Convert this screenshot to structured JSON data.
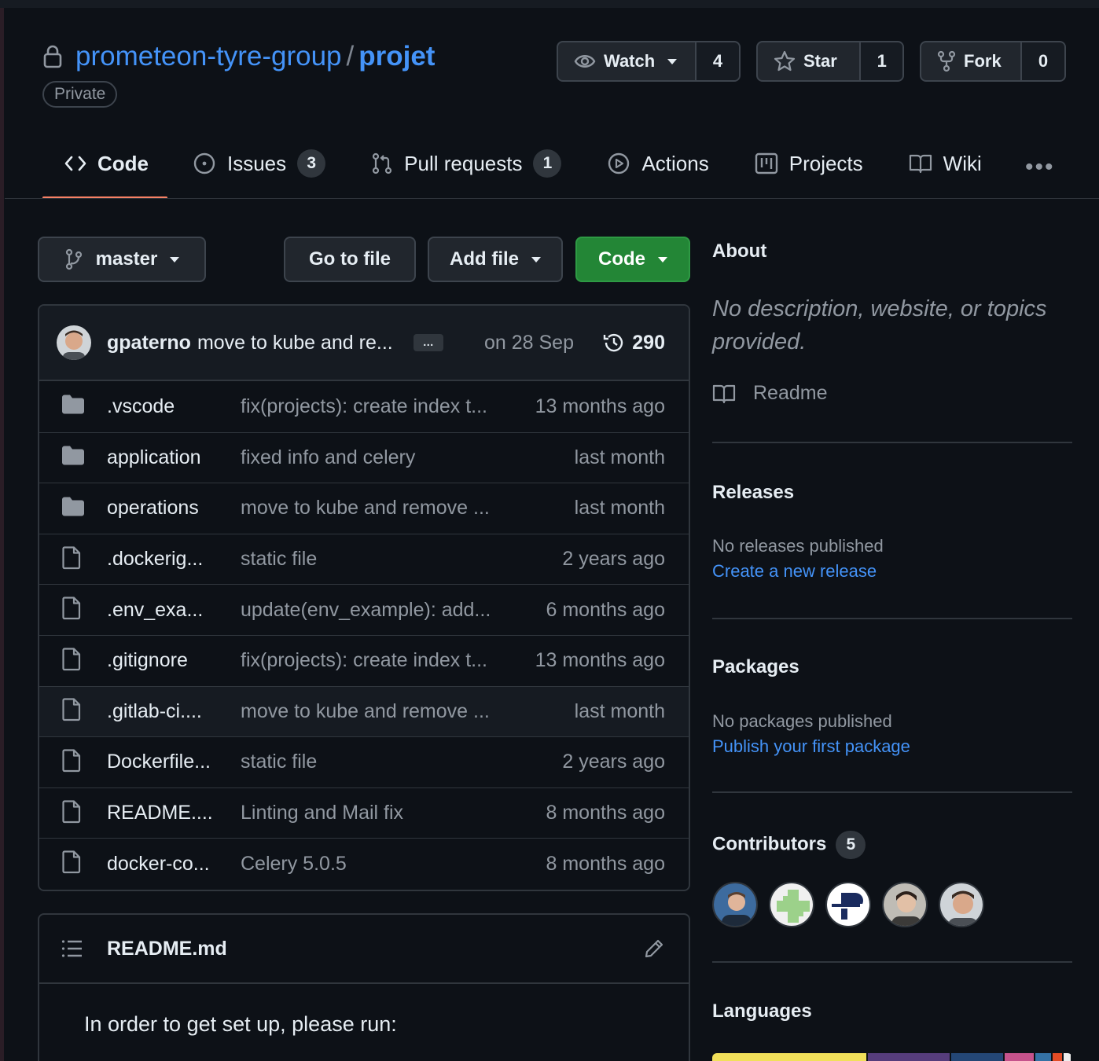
{
  "repo": {
    "owner": "prometeon-tyre-group",
    "separator": "/",
    "name": "projet",
    "visibility": "Private"
  },
  "header_buttons": {
    "watch": {
      "label": "Watch",
      "count": "4"
    },
    "star": {
      "label": "Star",
      "count": "1"
    },
    "fork": {
      "label": "Fork",
      "count": "0"
    }
  },
  "tabs": [
    {
      "label": "Code",
      "icon": "code-icon",
      "active": true
    },
    {
      "label": "Issues",
      "icon": "issue-icon",
      "count": "3"
    },
    {
      "label": "Pull requests",
      "icon": "pull-request-icon",
      "count": "1"
    },
    {
      "label": "Actions",
      "icon": "play-icon"
    },
    {
      "label": "Projects",
      "icon": "project-icon"
    },
    {
      "label": "Wiki",
      "icon": "book-icon"
    }
  ],
  "toolbar": {
    "branch": "master",
    "go_to_file": "Go to file",
    "add_file": "Add file",
    "code": "Code"
  },
  "latest_commit": {
    "author": "gpaterno",
    "message": "move to kube and re...",
    "ellipsis": "…",
    "date": "on 28 Sep",
    "commit_count": "290"
  },
  "files": [
    {
      "type": "folder",
      "name": ".vscode",
      "message": "fix(projects): create index t...",
      "age": "13 months ago"
    },
    {
      "type": "folder",
      "name": "application",
      "message": "fixed info and celery",
      "age": "last month"
    },
    {
      "type": "folder",
      "name": "operations",
      "message": "move to kube and remove ...",
      "age": "last month"
    },
    {
      "type": "file",
      "name": ".dockerig...",
      "message": "static file",
      "age": "2 years ago"
    },
    {
      "type": "file",
      "name": ".env_exa...",
      "message": "update(env_example): add...",
      "age": "6 months ago"
    },
    {
      "type": "file",
      "name": ".gitignore",
      "message": "fix(projects): create index t...",
      "age": "13 months ago"
    },
    {
      "type": "file",
      "name": ".gitlab-ci....",
      "message": "move to kube and remove ...",
      "age": "last month"
    },
    {
      "type": "file",
      "name": "Dockerfile...",
      "message": "static file",
      "age": "2 years ago"
    },
    {
      "type": "file",
      "name": "README....",
      "message": "Linting and Mail fix",
      "age": "8 months ago"
    },
    {
      "type": "file",
      "name": "docker-co...",
      "message": "Celery 5.0.5",
      "age": "8 months ago"
    }
  ],
  "readme": {
    "title": "README.md",
    "intro": "In order to get set up, please run:"
  },
  "sidebar": {
    "about_title": "About",
    "about_desc_line1": "No description, website, or topics",
    "about_desc_line2": "provided.",
    "readme_link": "Readme",
    "releases_title": "Releases",
    "releases_empty": "No releases published",
    "releases_link": "Create a new release",
    "packages_title": "Packages",
    "packages_empty": "No packages published",
    "packages_link": "Publish your first package",
    "contributors_title": "Contributors",
    "contributors_count": "5",
    "languages_title": "Languages"
  },
  "colors": {
    "accent_link": "#4493f8",
    "primary_button": "#238636",
    "tab_underline": "#f78166",
    "languages": [
      "#f1e05a",
      "#563d7c",
      "#244776",
      "#c6538c",
      "#3572A5",
      "#e34c26",
      "#ededed"
    ]
  }
}
